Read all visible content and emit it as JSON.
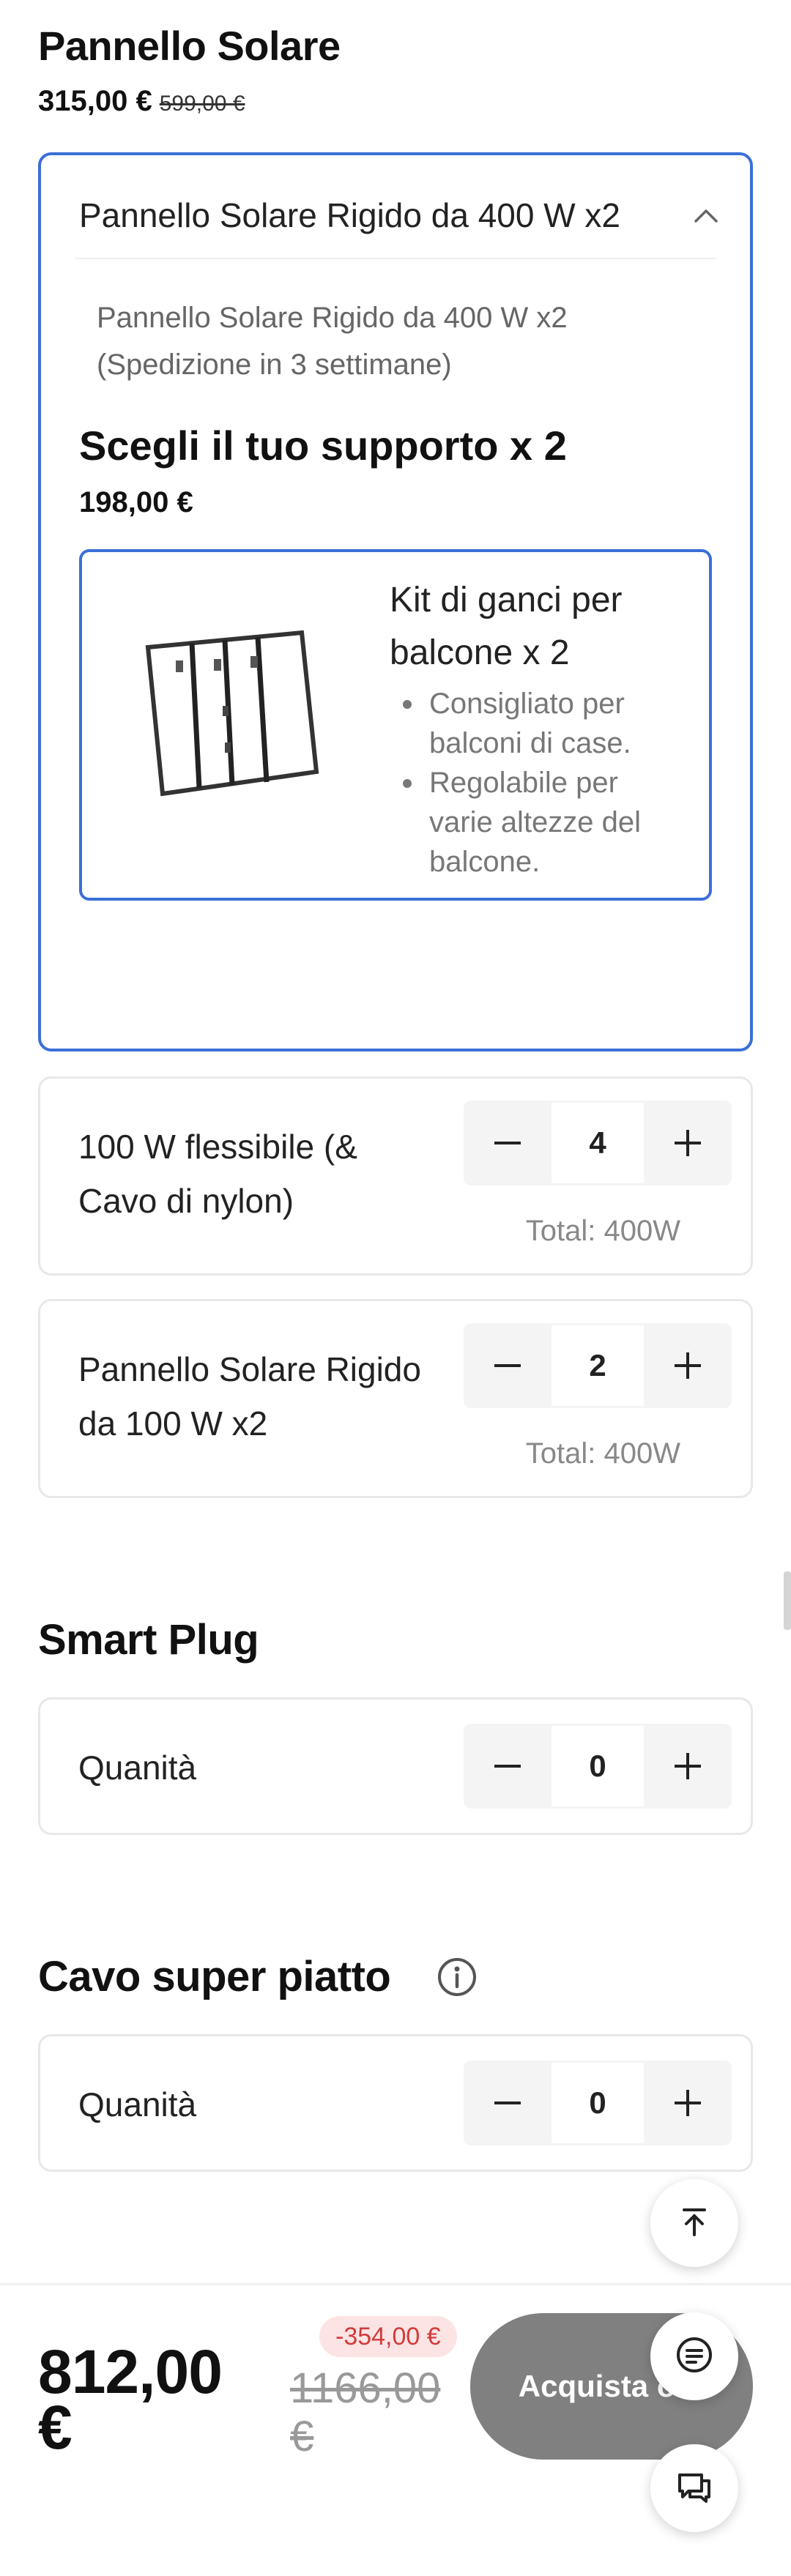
{
  "product": {
    "title": "Pannello Solare",
    "price": "315,00 €",
    "old_price": "599,00 €"
  },
  "expander": {
    "title": "Pannello Solare Rigido da 400 W x2",
    "description": "Pannello Solare Rigido da 400 W x2 (Spedizione in 3 settimane)",
    "support_title": "Scegli il tuo supporto x 2",
    "support_price": "198,00 €",
    "option": {
      "title": "Kit di ganci per balcone x 2",
      "bullets": [
        "Consigliato per balconi di case.",
        "Regolabile per varie altezze del balcone."
      ]
    }
  },
  "items": [
    {
      "label": "100 W flessibile (& Cavo di nylon)",
      "quantity": "4",
      "total": "Total: 400W"
    },
    {
      "label": "Pannello Solare Rigido da 100 W x2",
      "quantity": "2",
      "total": "Total: 400W"
    }
  ],
  "smart_plug": {
    "title": "Smart Plug",
    "label": "Quanità",
    "quantity": "0"
  },
  "cable": {
    "title": "Cavo super piatto",
    "label": "Quanità",
    "quantity": "0"
  },
  "footer": {
    "total": "812,00 €",
    "discount": "-354,00 €",
    "old_total": "1166,00 €",
    "buy_label": "Acquista ora"
  },
  "icons": {
    "collapse": "chevron-up-icon",
    "minus": "minus-icon",
    "plus": "plus-icon",
    "info": "info-icon",
    "back_to_top": "arrow-up-to-top-icon",
    "chat": "chat-bubble-icon",
    "messages": "message-icon"
  },
  "colors": {
    "accent_border": "#3a6fd8",
    "buy_button": "#808080",
    "discount_bg": "#fde4e4",
    "discount_text": "#d13b3b"
  }
}
